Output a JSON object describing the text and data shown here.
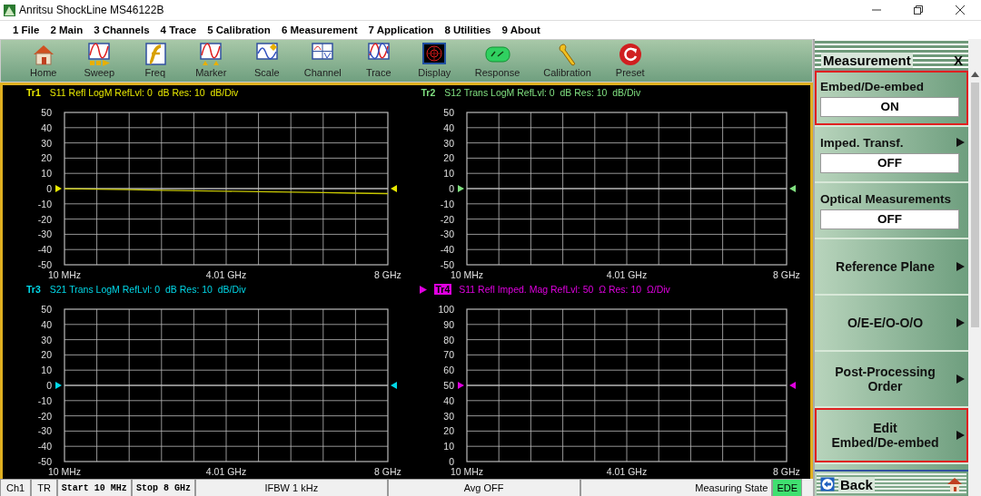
{
  "window": {
    "title": "Anritsu ShockLine MS46122B"
  },
  "menu": [
    "1 File",
    "2 Main",
    "3 Channels",
    "4 Trace",
    "5 Calibration",
    "6 Measurement",
    "7 Application",
    "8 Utilities",
    "9 About"
  ],
  "toolbar": [
    {
      "label": "Home"
    },
    {
      "label": "Sweep"
    },
    {
      "label": "Freq"
    },
    {
      "label": "Marker"
    },
    {
      "label": "Scale"
    },
    {
      "label": "Channel"
    },
    {
      "label": "Trace"
    },
    {
      "label": "Display"
    },
    {
      "label": "Response"
    },
    {
      "label": "Calibration"
    },
    {
      "label": "Preset"
    }
  ],
  "traces": [
    {
      "label": "Tr1",
      "description": "S11 Refl LogM RefLvl: 0  dB Res: 10  dB/Div",
      "color": "#e8e800",
      "selected": false,
      "chart_data": {
        "type": "line",
        "grid": true,
        "categories": [
          "10 MHz",
          null,
          null,
          null,
          null,
          "4.01 GHz",
          null,
          null,
          null,
          null,
          "8 GHz"
        ],
        "ylim": [
          -50,
          50
        ],
        "yticks": [
          50,
          40,
          30,
          20,
          10,
          0,
          -10,
          -20,
          -30,
          -40,
          -50
        ],
        "ref_lines": [
          {
            "axis": "y",
            "value": 0
          }
        ],
        "series": [
          {
            "color": "#c8c800",
            "values": [
              -0.1,
              -0.4,
              -0.7,
              -1.1,
              -1.4,
              -1.7,
              -2.0,
              -2.3,
              -2.6,
              -3.0,
              -3.3
            ]
          }
        ]
      }
    },
    {
      "label": "Tr2",
      "description": "S12 Trans LogM RefLvl: 0  dB Res: 10  dB/Div",
      "color": "#80e080",
      "selected": false,
      "chart_data": {
        "type": "line",
        "grid": true,
        "categories": [
          "10 MHz",
          null,
          null,
          null,
          null,
          "4.01 GHz",
          null,
          null,
          null,
          null,
          "8 GHz"
        ],
        "ylim": [
          -50,
          50
        ],
        "yticks": [
          50,
          40,
          30,
          20,
          10,
          0,
          -10,
          -20,
          -30,
          -40,
          -50
        ],
        "ref_lines": [
          {
            "axis": "y",
            "value": 0
          }
        ]
      }
    },
    {
      "label": "Tr3",
      "description": "S21 Trans LogM RefLvl: 0  dB Res: 10  dB/Div",
      "color": "#00d8e8",
      "selected": false,
      "chart_data": {
        "type": "line",
        "grid": true,
        "categories": [
          "10 MHz",
          null,
          null,
          null,
          null,
          "4.01 GHz",
          null,
          null,
          null,
          null,
          "8 GHz"
        ],
        "ylim": [
          -50,
          50
        ],
        "yticks": [
          50,
          40,
          30,
          20,
          10,
          0,
          -10,
          -20,
          -30,
          -40,
          -50
        ],
        "ref_lines": [
          {
            "axis": "y",
            "value": 0
          }
        ]
      }
    },
    {
      "label": "Tr4",
      "description": "S11 Refl Imped. Mag RefLvl: 50  Ω Res: 10  Ω/Div",
      "color": "#e000e0",
      "selected": true,
      "chart_data": {
        "type": "line",
        "grid": true,
        "categories": [
          "10 MHz",
          null,
          null,
          null,
          null,
          "4.01 GHz",
          null,
          null,
          null,
          null,
          "8 GHz"
        ],
        "ylim": [
          0,
          100
        ],
        "yticks": [
          100,
          90,
          80,
          70,
          60,
          50,
          40,
          30,
          20,
          10,
          0
        ],
        "ref_lines": [
          {
            "axis": "y",
            "value": 50
          }
        ]
      }
    }
  ],
  "panel": {
    "title": "Measurement",
    "close": "X",
    "items": [
      {
        "label": "Embed/De-embed",
        "value": "ON",
        "submenu": false,
        "highlighted": true
      },
      {
        "label": "Imped. Transf.",
        "value": "OFF",
        "submenu": true,
        "highlighted": false
      },
      {
        "label": "Optical Measurements",
        "value": "OFF",
        "submenu": false,
        "highlighted": false
      },
      {
        "label": "Reference Plane",
        "submenu": true,
        "highlighted": false
      },
      {
        "label": "O/E-E/O-O/O",
        "submenu": true,
        "highlighted": false
      },
      {
        "label": "Post-Processing\nOrder",
        "submenu": true,
        "highlighted": false
      },
      {
        "label": "Edit\nEmbed/De-embed",
        "submenu": true,
        "highlighted": true
      }
    ],
    "back": "Back"
  },
  "status_bar": [
    {
      "text": "Ch1",
      "kind": "plain"
    },
    {
      "text": "TR",
      "kind": "plain"
    },
    {
      "text": "Start 10 MHz",
      "kind": "setting"
    },
    {
      "text": "Stop 8 GHz",
      "kind": "setting"
    },
    {
      "text": "IFBW 1 kHz",
      "kind": "field"
    },
    {
      "text": "Avg OFF",
      "kind": "field"
    },
    {
      "text": "Measuring State",
      "kind": "state"
    },
    {
      "text": "EDE",
      "kind": "indicator",
      "on": true
    }
  ]
}
